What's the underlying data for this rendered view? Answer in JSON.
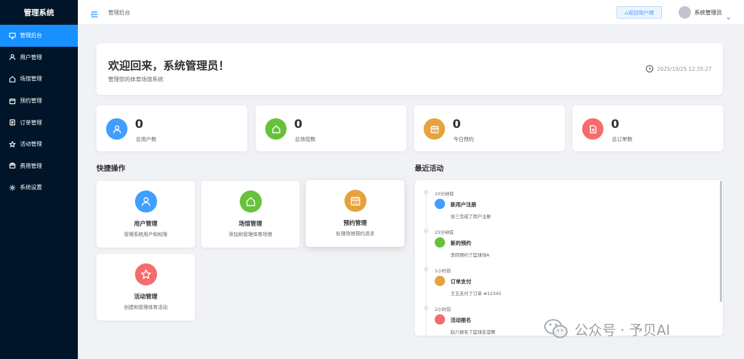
{
  "sidebar": {
    "brand": "管理系统",
    "items": [
      {
        "label": "管理后台",
        "icon": "monitor-icon"
      },
      {
        "label": "用户管理",
        "icon": "user-icon"
      },
      {
        "label": "场馆管理",
        "icon": "house-icon"
      },
      {
        "label": "预约管理",
        "icon": "calendar-icon"
      },
      {
        "label": "订单管理",
        "icon": "document-icon"
      },
      {
        "label": "活动管理",
        "icon": "star-icon"
      },
      {
        "label": "费用管理",
        "icon": "wallet-icon"
      },
      {
        "label": "系统设置",
        "icon": "gear-icon"
      }
    ],
    "active_index": 0,
    "bg_color": "#001529",
    "active_color": "#1890ff"
  },
  "header": {
    "breadcrumb": "管理后台",
    "back_button": "⌂返回用户端",
    "username": "系统管理员"
  },
  "welcome": {
    "title": "欢迎回来，系统管理员！",
    "subtitle": "管理您的体育场馆系统",
    "datetime": "2025/10/25 12:35:27"
  },
  "stats": [
    {
      "value": "0",
      "label": "总用户数",
      "color": "#409eff",
      "icon": "user-icon"
    },
    {
      "value": "0",
      "label": "总场馆数",
      "color": "#67c23a",
      "icon": "house-icon"
    },
    {
      "value": "0",
      "label": "今日预约",
      "color": "#e6a23c",
      "icon": "calendar-icon"
    },
    {
      "value": "0",
      "label": "总订单数",
      "color": "#f56c6c",
      "icon": "document-icon"
    }
  ],
  "quick": {
    "title": "快捷操作",
    "items": [
      {
        "title": "用户管理",
        "desc": "管理系统用户和权限",
        "color": "#409eff",
        "icon": "user-icon"
      },
      {
        "title": "场馆管理",
        "desc": "添加和管理体育场馆",
        "color": "#67c23a",
        "icon": "house-icon"
      },
      {
        "title": "预约管理",
        "desc": "处理场馆预约请求",
        "color": "#e6a23c",
        "icon": "calendar-icon"
      },
      {
        "title": "活动管理",
        "desc": "创建和管理体育活动",
        "color": "#f56c6c",
        "icon": "star-icon"
      }
    ]
  },
  "activity": {
    "title": "最近活动",
    "items": [
      {
        "time": "10分钟前",
        "title": "新用户注册",
        "desc": "张三完成了用户注册",
        "color": "#409eff"
      },
      {
        "time": "25分钟前",
        "title": "新的预约",
        "desc": "李四预约了篮球场A",
        "color": "#67c23a"
      },
      {
        "time": "1小时前",
        "title": "订单支付",
        "desc": "王五支付了订单 #12345",
        "color": "#e6a23c"
      },
      {
        "time": "2小时前",
        "title": "活动报名",
        "desc": "赵六报名了篮球友谊赛",
        "color": "#f56c6c"
      }
    ]
  },
  "watermark": {
    "text": "公众号 · 予贝AI",
    "icon": "wechat-icon"
  }
}
